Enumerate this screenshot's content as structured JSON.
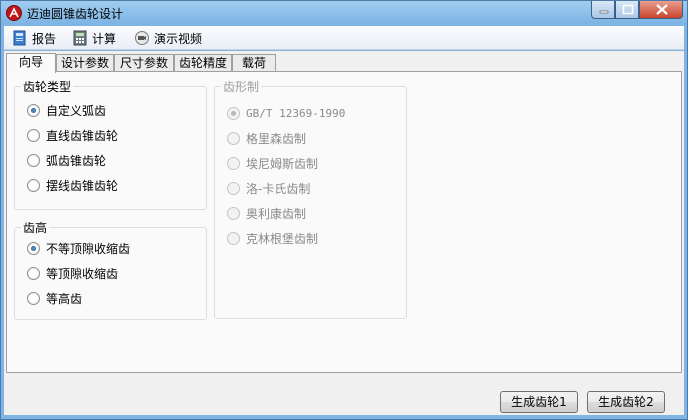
{
  "window": {
    "title": "迈迪圆锥齿轮设计"
  },
  "menu": [
    {
      "name": "report",
      "label": "报告",
      "icon": "report-book-icon"
    },
    {
      "name": "calculate",
      "label": "计算",
      "icon": "calculator-icon"
    },
    {
      "name": "demo-video",
      "label": "演示视频",
      "icon": "video-camera-icon"
    }
  ],
  "tabs": [
    "向导",
    "设计参数",
    "尺寸参数",
    "齿轮精度",
    "载荷"
  ],
  "active_tab": "向导",
  "groups": {
    "gear_type": {
      "title": "齿轮类型",
      "options": [
        "自定义弧齿",
        "直线齿锥齿轮",
        "弧齿锥齿轮",
        "摆线齿锥齿轮"
      ],
      "selected": "自定义弧齿"
    },
    "tooth_height": {
      "title": "齿高",
      "options": [
        "不等顶隙收缩齿",
        "等顶隙收缩齿",
        "等高齿"
      ],
      "selected": "不等顶隙收缩齿"
    },
    "tooth_form": {
      "title": "齿形制",
      "options": [
        "GB/T 12369-1990",
        "格里森齿制",
        "埃尼姆斯齿制",
        "洛-卡氏齿制",
        "奥利康齿制",
        "克林根堡齿制"
      ],
      "selected": "GB/T 12369-1990",
      "disabled": true
    }
  },
  "buttons": {
    "gen1": "生成齿轮1",
    "gen2": "生成齿轮2"
  },
  "colors": {
    "titlebar": "#7fb5e4",
    "close": "#c9442c",
    "accent": "#1b4b86"
  }
}
